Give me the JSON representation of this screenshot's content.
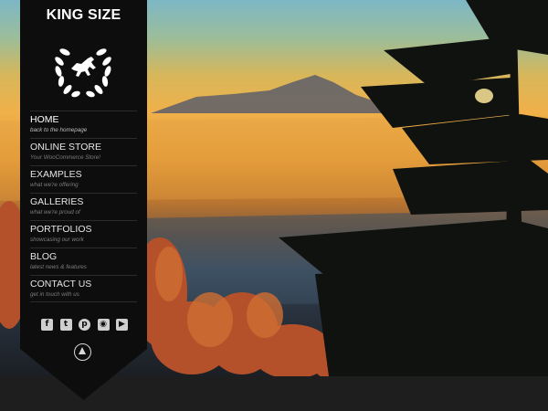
{
  "site": {
    "title": "KING SIZE"
  },
  "nav": [
    {
      "title": "HOME",
      "subtitle": "back to the homepage"
    },
    {
      "title": "ONLINE STORE",
      "subtitle": "Your WooCommerce Store!"
    },
    {
      "title": "EXAMPLES",
      "subtitle": "what we're offering"
    },
    {
      "title": "GALLERIES",
      "subtitle": "what we're proud of"
    },
    {
      "title": "PORTFOLIOS",
      "subtitle": "showcasing our work"
    },
    {
      "title": "BLOG",
      "subtitle": "latest news & features"
    },
    {
      "title": "CONTACT US",
      "subtitle": "get in touch with us"
    }
  ],
  "social": [
    {
      "icon": "facebook-icon",
      "glyph": "f"
    },
    {
      "icon": "twitter-icon",
      "glyph": "t"
    },
    {
      "icon": "pinterest-icon",
      "glyph": "p"
    },
    {
      "icon": "instagram-icon",
      "glyph": "◉"
    },
    {
      "icon": "youtube-icon",
      "glyph": "▶"
    }
  ],
  "colors": {
    "sidebar": "#0d0d0d",
    "footer": "#1e1e1e"
  }
}
